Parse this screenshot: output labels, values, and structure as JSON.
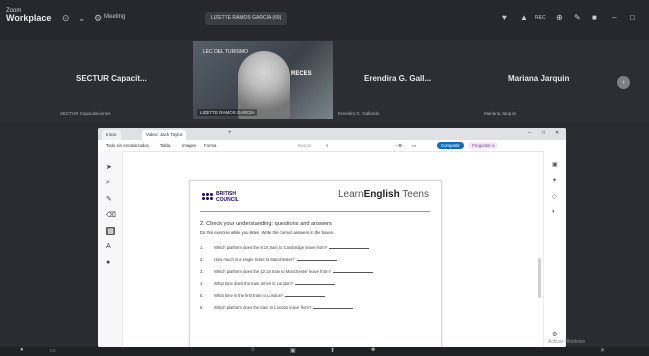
{
  "app": {
    "name_small": "Zoom",
    "name": "Workplace"
  },
  "topbar": {
    "meeting_label": "Meeting",
    "share_label": "LIZETTE RAMOS GARCÍA (69)",
    "rec_label": "REC"
  },
  "participants": [
    {
      "name": "SECTUR Capacit...",
      "tag": "SECTUR Capacitaciones"
    },
    {
      "name": "Erendira G. Gall...",
      "tag": "Erendira G. Gallardo"
    },
    {
      "name": "Mariana Jarquin",
      "tag": "Mariana Jarquin"
    }
  ],
  "video_tile": {
    "caption": "LIZETTE RAMOS GARCÍA",
    "poster": "LEC DEL TURISMO",
    "poster2": "RECES"
  },
  "browser": {
    "tabs": [
      {
        "label": "Inicio"
      },
      {
        "label": "Video: Jack Taylor"
      }
    ],
    "new_tab": "+",
    "toolbar": {
      "items": [
        "Todo sin encabezados",
        "Tabla",
        "Imagen",
        "Forma"
      ],
      "search": "Buscar",
      "share_button": "Compartir",
      "more_button": "Preguntar a"
    }
  },
  "document": {
    "bc_line1": "BRITISH",
    "bc_line2": "COUNCIL",
    "le_part1": "Learn",
    "le_bold": "English",
    "le_part2": " Teens",
    "task_title": "2.  Check your understanding: questions and answers",
    "task_sub": "Do this exercise while you listen. Write the correct answers in the boxes.",
    "questions": [
      {
        "num": "1.",
        "text": "Which platform does the 9:15 train to Cambridge leave from?"
      },
      {
        "num": "2.",
        "text": "How much is a single ticket to Manchester?"
      },
      {
        "num": "3.",
        "text": "Which platform does the 12:15 train to Manchester leave from?"
      },
      {
        "num": "4.",
        "text": "What time does the train arrive in London?"
      },
      {
        "num": "5.",
        "text": "What time is the first train to London?"
      },
      {
        "num": "6.",
        "text": "Which platform does the train to London leave from?"
      }
    ]
  },
  "watermark": "Activar Windows",
  "colors": {
    "share_button": "#0f6cbd",
    "bc_purple": "#23085a"
  }
}
